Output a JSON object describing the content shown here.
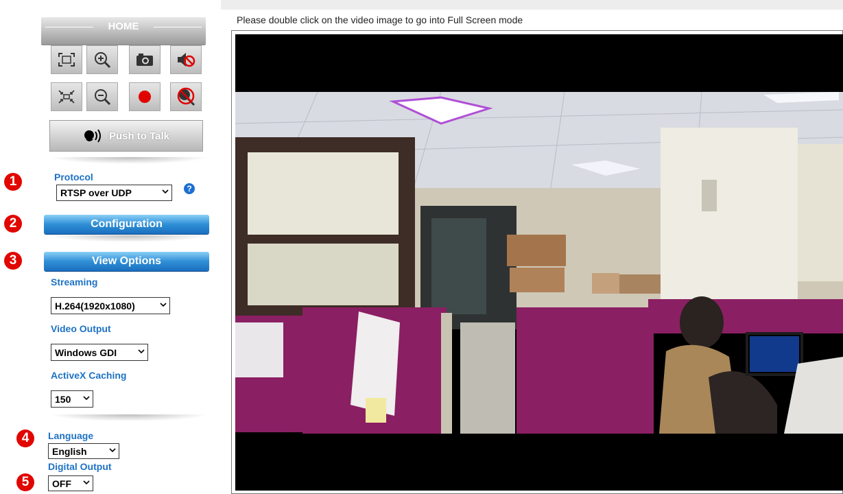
{
  "toolbar": {
    "home_label": "HOME",
    "push_to_talk_label": "Push to Talk"
  },
  "sections": {
    "protocol": {
      "num": "1",
      "label": "Protocol",
      "value": "RTSP over UDP"
    },
    "configuration": {
      "num": "2",
      "label": "Configuration"
    },
    "view_options": {
      "num": "3",
      "label": "View Options",
      "streaming_label": "Streaming",
      "streaming_value": "H.264(1920x1080)",
      "video_output_label": "Video Output",
      "video_output_value": "Windows GDI",
      "activex_label": "ActiveX Caching",
      "activex_value": "150"
    },
    "language": {
      "num": "4",
      "label": "Language",
      "value": "English"
    },
    "digital_output": {
      "num": "5",
      "label": "Digital Output",
      "value": "OFF"
    }
  },
  "hint": "Please double click on the video image to go into Full Screen mode",
  "help_glyph": "?",
  "colors": {
    "accent_blue": "#1d72c4",
    "badge_red": "#e10600",
    "record_red": "#e00000",
    "cubicle_magenta": "#8b1f63"
  }
}
